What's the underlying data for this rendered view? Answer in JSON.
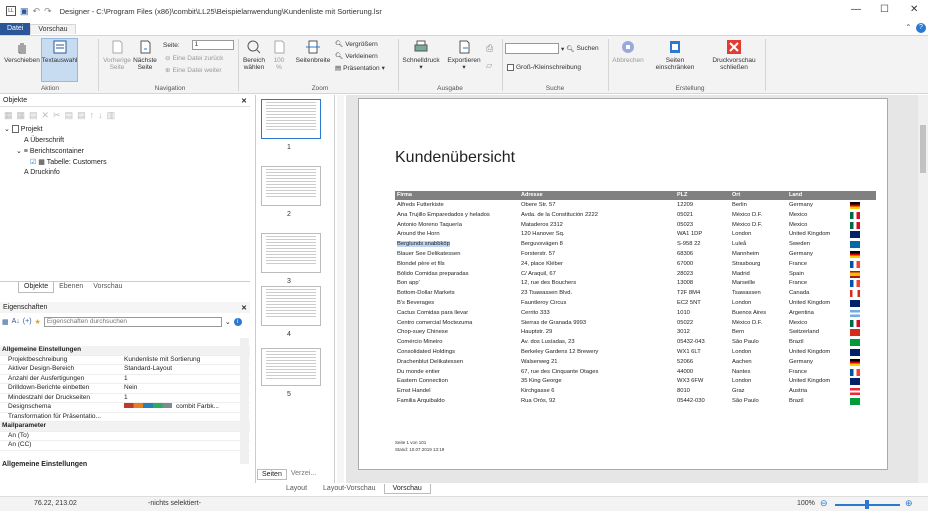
{
  "window": {
    "title": "Designer - C:\\Program Files (x86)\\combit\\LL25\\Beispielanwendung\\Kundenliste mit Sortierung.lsr",
    "minimize": "—",
    "maximize": "☐",
    "close": "✕"
  },
  "menu_tabs": [
    "Datei",
    "Vorschau"
  ],
  "ribbon": {
    "verschieben": "Verschieben",
    "textauswahl": "Textauswahl",
    "vorherige": "Vorherige\nSeite",
    "naechste": "Nächste\nSeite",
    "seite_label": "Seite:",
    "seite_value": "1",
    "eine_datei_zurueck": "Eine Datei zurück",
    "eine_datei_weiter": "Eine Datei weiter",
    "bereich": "Bereich\nwählen",
    "zoom100": "100\n%",
    "seitenbreite": "Seitenbreite",
    "vergroessern": "Vergrößern",
    "verkleinern": "Verkleinern",
    "praesentation": "Präsentation",
    "schnelldruck": "Schnelldruck",
    "exportieren": "Exportieren",
    "suchen": "Suchen",
    "gross_klein": "Groß-/Kleinschreibung",
    "abbrechen": "Abbrechen",
    "seiten_einschraenken": "Seiten\neinschränken",
    "druckvorschau_schliessen": "Druckvorschau\nschließen",
    "groups": [
      "Aktion",
      "Navigation",
      "Zoom",
      "Ausgabe",
      "Suche",
      "Erstellung"
    ]
  },
  "objects_panel": {
    "title": "Objekte",
    "tree": [
      "Projekt",
      "A  Überschrift",
      "Berichtscontainer",
      "Tabelle: Customers",
      "A  Druckinfo"
    ],
    "tabs": [
      "Objekte",
      "Ebenen",
      "Vorschau"
    ]
  },
  "properties_panel": {
    "title": "Eigenschaften",
    "search_placeholder": "Eigenschaften durchsuchen",
    "rows": [
      {
        "k": "Allgemeine Einstellungen",
        "v": "",
        "cat": true
      },
      {
        "k": "Projektbeschreibung",
        "v": "Kundenliste mit Sortierung"
      },
      {
        "k": "Aktiver Design-Bereich",
        "v": "Standard-Layout"
      },
      {
        "k": "Anzahl der Ausfertigungen",
        "v": "1"
      },
      {
        "k": "Drilldown-Berichte einbetten",
        "v": "Nein"
      },
      {
        "k": "Mindestzahl der Druckseiten",
        "v": "1"
      },
      {
        "k": "Designschema",
        "v": "combit Farbk..."
      },
      {
        "k": "Transformation für Präsentatio...",
        "v": ""
      },
      {
        "k": "Mailparameter",
        "v": "",
        "cat": true
      },
      {
        "k": "An (To)",
        "v": ""
      },
      {
        "k": "An (CC)",
        "v": ""
      }
    ],
    "footer": "Allgemeine Einstellungen"
  },
  "thumbs": {
    "numbers": [
      "1",
      "2",
      "3",
      "4",
      "5"
    ],
    "tabs": [
      "Seiten",
      "Verzei..."
    ]
  },
  "preview": {
    "title": "Kundenübersicht",
    "headers": [
      "Firma",
      "Adresse",
      "PLZ",
      "Ort",
      "Land"
    ],
    "rows": [
      [
        "Alfreds Futterkiste",
        "Obere Str. 57",
        "12209",
        "Berlin",
        "Germany"
      ],
      [
        "Ana Trujillo Emparedados y helados",
        "Avda. de la Constitución 2222",
        "05021",
        "México D.F.",
        "Mexico"
      ],
      [
        "Antonio Moreno Taquería",
        "Mataderos 2312",
        "05023",
        "México D.F.",
        "Mexico"
      ],
      [
        "Around the Horn",
        "120 Hanover Sq.",
        "WA1 1DP",
        "London",
        "United Kingdom"
      ],
      [
        "Berglunds snabbköp",
        "Berguvsvägen 8",
        "S-958 22",
        "Luleå",
        "Sweden"
      ],
      [
        "Blauer See Delikatessen",
        "Forsterstr. 57",
        "68306",
        "Mannheim",
        "Germany"
      ],
      [
        "Blondel père et fils",
        "24, place Kléber",
        "67000",
        "Strasbourg",
        "France"
      ],
      [
        "Bólido Comidas preparadas",
        "C/ Araquil, 67",
        "28023",
        "Madrid",
        "Spain"
      ],
      [
        "Bon app'",
        "12, rue des Bouchers",
        "13008",
        "Marseille",
        "France"
      ],
      [
        "Bottom-Dollar Markets",
        "23 Tsawassen Blvd.",
        "T2F 8M4",
        "Tsawassen",
        "Canada"
      ],
      [
        "B's Beverages",
        "Fauntleroy Circus",
        "EC2 5NT",
        "London",
        "United Kingdom"
      ],
      [
        "Cactus Comidas para llevar",
        "Cerrito 333",
        "1010",
        "Buenos Aires",
        "Argentina"
      ],
      [
        "Centro comercial Moctezuma",
        "Sierras de Granada 9993",
        "05022",
        "México D.F.",
        "Mexico"
      ],
      [
        "Chop-suey Chinese",
        "Hauptstr. 29",
        "3012",
        "Bern",
        "Switzerland"
      ],
      [
        "Comércio Mineiro",
        "Av. dos Lusíadas, 23",
        "05432-043",
        "São Paulo",
        "Brazil"
      ],
      [
        "Consolidated Holdings",
        "Berkeley Gardens 12 Brewery",
        "WX1 6LT",
        "London",
        "United Kingdom"
      ],
      [
        "Drachenblut Delikatessen",
        "Walserweg 21",
        "52066",
        "Aachen",
        "Germany"
      ],
      [
        "Du monde entier",
        "67, rue des Cinquante Otages",
        "44000",
        "Nantes",
        "France"
      ],
      [
        "Eastern Connection",
        "35 King George",
        "WX3 6FW",
        "London",
        "United Kingdom"
      ],
      [
        "Ernst Handel",
        "Kirchgasse 6",
        "8010",
        "Graz",
        "Austria"
      ],
      [
        "Familia Arquibaldo",
        "Rua Orós, 92",
        "05442-030",
        "São Paulo",
        "Brazil"
      ]
    ],
    "footer1": "Seite 1 von 101",
    "footer2": "Stand: 10.07.2019 13:19"
  },
  "bottom_tabs": [
    "Layout",
    "Layout-Vorschau",
    "Vorschau"
  ],
  "status": {
    "coords": "76.22, 213.02",
    "selection": "-nichts selektiert-",
    "zoom": "100%"
  }
}
